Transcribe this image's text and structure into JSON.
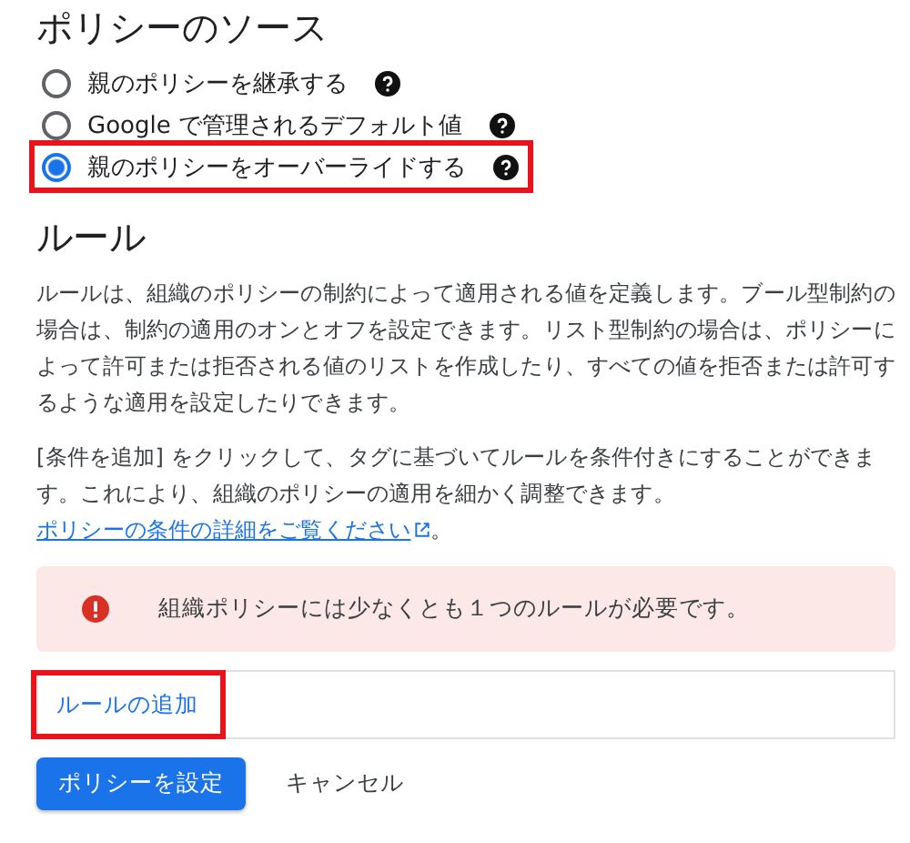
{
  "policy_source": {
    "heading": "ポリシーのソース",
    "options": [
      {
        "label": "親のポリシーを継承する",
        "selected": false,
        "highlighted": false
      },
      {
        "label": "Google で管理されるデフォルト値",
        "selected": false,
        "highlighted": false
      },
      {
        "label": "親のポリシーをオーバーライドする",
        "selected": true,
        "highlighted": true
      }
    ]
  },
  "rules": {
    "heading": "ルール",
    "description": "ルールは、組織のポリシーの制約によって適用される値を定義します。ブール型制約の場合は、制約の適用のオンとオフを設定できます。リスト型制約の場合は、ポリシーによって許可または拒否される値のリストを作成したり、すべての値を拒否または許可するような適用を設定したりできます。",
    "conditions_text": "[条件を追加] をクリックして、タグに基づいてルールを条件付きにすることができます。これにより、組織のポリシーの適用を細かく調整できます。",
    "conditions_link": "ポリシーの条件の詳細をご覧ください",
    "conditions_end": "。"
  },
  "alert": {
    "message": "組織ポリシーには少なくとも１つのルールが必要です。"
  },
  "add_rule": {
    "label": "ルールの追加",
    "highlighted": true
  },
  "buttons": [
    {
      "label": "ポリシーを設定",
      "kind": "primary"
    },
    {
      "label": "キャンセル",
      "kind": "text"
    }
  ]
}
